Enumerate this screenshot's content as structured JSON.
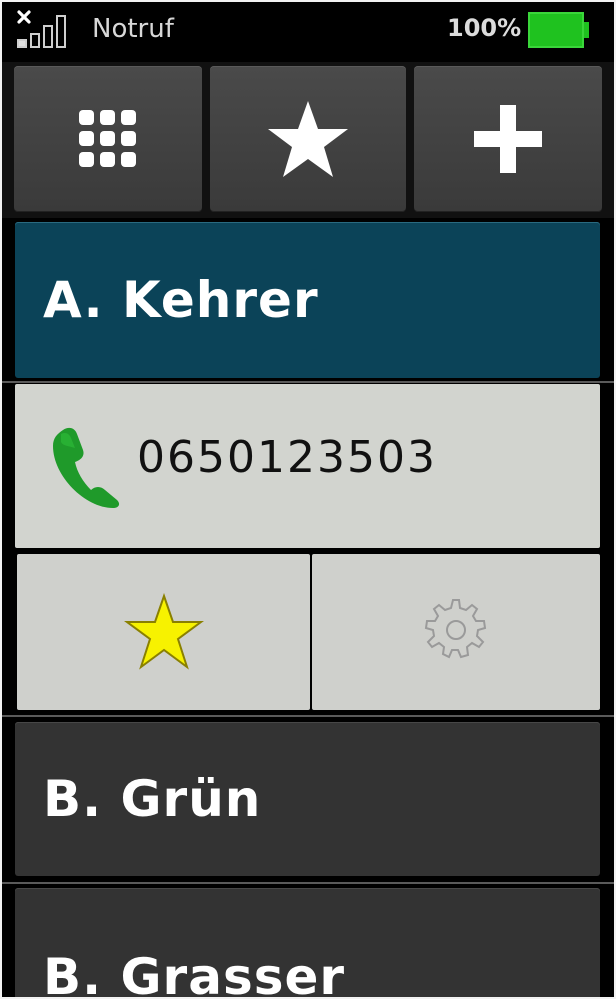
{
  "status_bar": {
    "carrier": "Notruf",
    "battery_percent": "100%",
    "battery_level": 1.0,
    "no_signal_icon": "x-icon",
    "signal_icon": "signal-bars-icon"
  },
  "toolbar": {
    "buttons": [
      {
        "name": "dialpad",
        "icon": "dialpad-icon"
      },
      {
        "name": "favorites",
        "icon": "star-icon"
      },
      {
        "name": "add",
        "icon": "plus-icon"
      }
    ]
  },
  "contacts": [
    {
      "name": "A. Kehrer",
      "selected": true
    },
    {
      "name": "B. Grün",
      "selected": false
    },
    {
      "name": "B. Grasser",
      "selected": false
    }
  ],
  "selected_contact": {
    "phone_number": "0650123503",
    "call_icon": "phone-icon",
    "favorite_icon": "star-icon",
    "settings_icon": "gear-icon"
  },
  "colors": {
    "selected_bg": "#0b4358",
    "item_bg": "#333333",
    "detail_bg": "#d2d4cf",
    "battery_green": "#1fc21f",
    "call_green": "#1f9a2a",
    "favorite_yellow": "#f7f200"
  }
}
